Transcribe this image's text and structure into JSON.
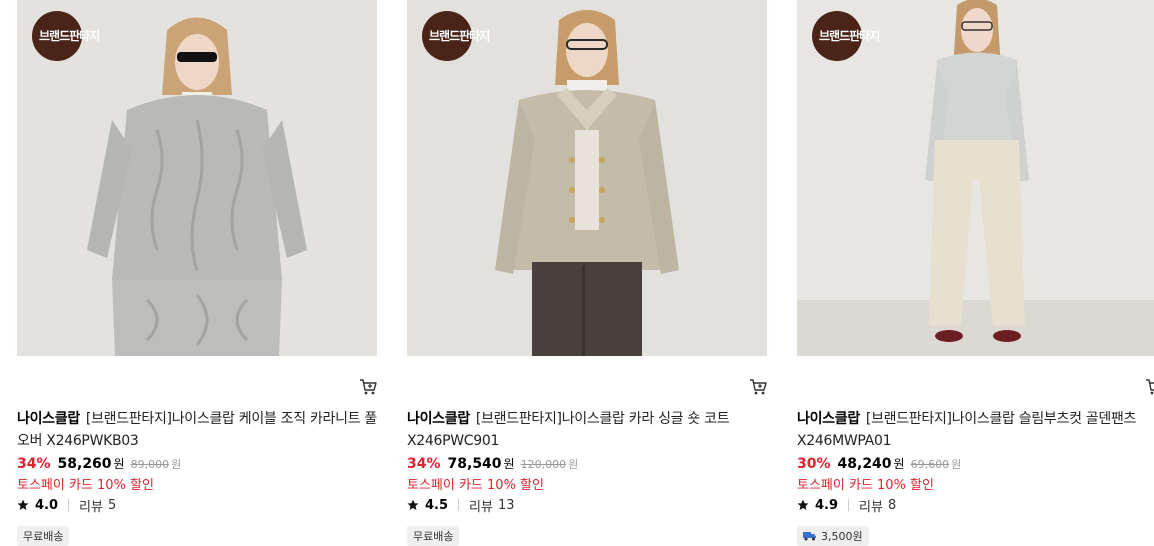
{
  "products": [
    {
      "badge": "브랜드판타지",
      "brand": "나이스클랍",
      "name": "[브랜드판타지]나이스클랍 케이블 조직 카라니트 풀오버 X246PWKB03",
      "discount": "34%",
      "price": "58,260",
      "price_unit": "원",
      "original_price": "89,000",
      "original_unit": "원",
      "promo": "토스페이 카드 10% 할인",
      "rating": "4.0",
      "review_label": "리뷰",
      "review_count": "5",
      "shipping": "무료배송",
      "colors": {
        "garment": "#b9b9b7",
        "background": "#e4e2de"
      }
    },
    {
      "badge": "브랜드판타지",
      "brand": "나이스클랍",
      "name": "[브랜드판타지]나이스클랍 카라 싱글 숏 코트 X246PWC901",
      "discount": "34%",
      "price": "78,540",
      "price_unit": "원",
      "original_price": "120,000",
      "original_unit": "원",
      "promo": "토스페이 카드 10% 할인",
      "rating": "4.5",
      "review_label": "리뷰",
      "review_count": "13",
      "shipping": "무료배송",
      "colors": {
        "garment": "#c4bca9",
        "background": "#e3e1dd"
      }
    },
    {
      "badge": "브랜드판타지",
      "brand": "나이스클랍",
      "name": "[브랜드판타지]나이스클랍 슬림부츠컷 골덴팬츠 X246MWPA01",
      "discount": "30%",
      "price": "48,240",
      "price_unit": "원",
      "original_price": "69,600",
      "original_unit": "원",
      "promo": "토스페이 카드 10% 할인",
      "rating": "4.9",
      "review_label": "리뷰",
      "review_count": "8",
      "shipping": "3,500원",
      "colors": {
        "garment": "#e6e1cf",
        "background": "#e8e6e2"
      }
    }
  ],
  "icons": {
    "cart": "shopping-cart-icon",
    "star": "star-icon",
    "truck": "delivery-truck-icon"
  },
  "accent_color": "#e0232d"
}
